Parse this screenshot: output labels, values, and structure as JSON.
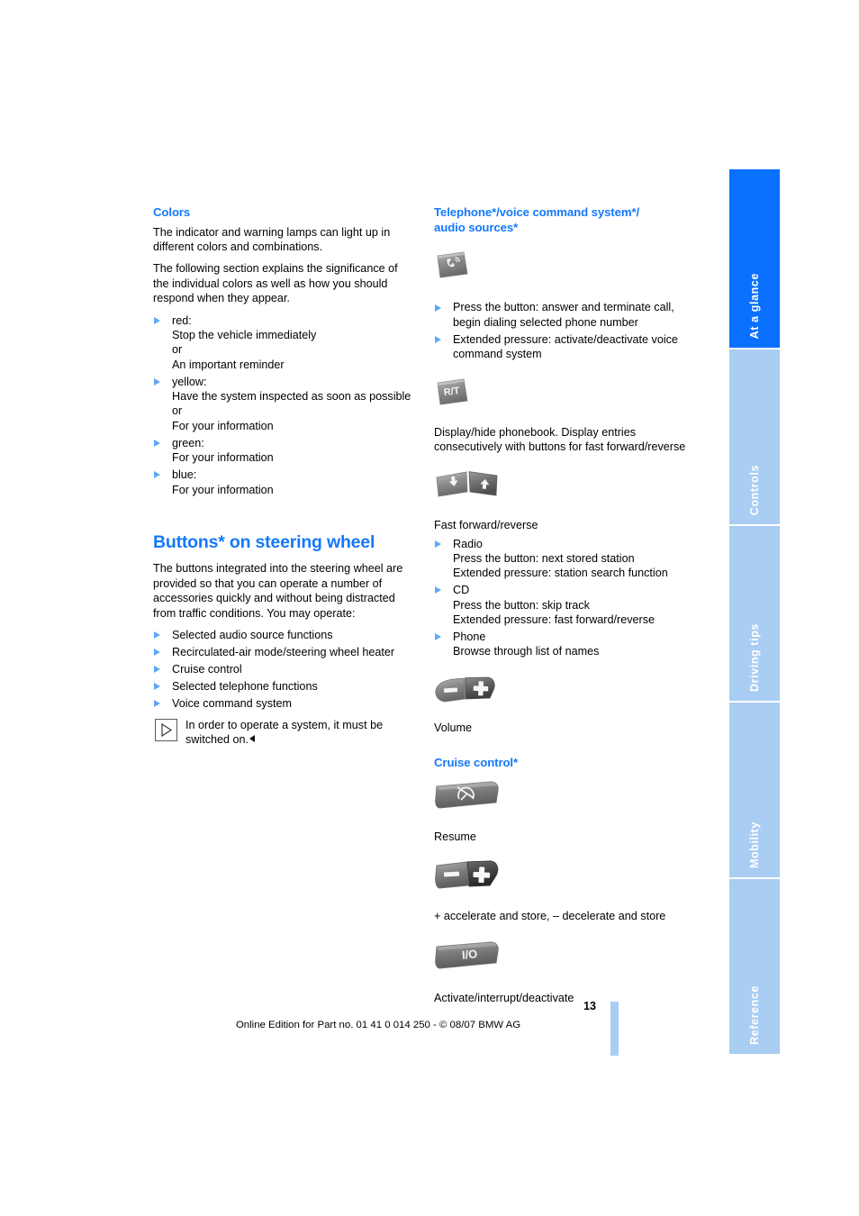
{
  "meta": {
    "page_number": "13",
    "copyright": "Online Edition for Part no. 01 41 0 014 250 - © 08/07 BMW AG"
  },
  "tabs": [
    {
      "label": "At a glance",
      "active": true
    },
    {
      "label": "Controls",
      "active": false
    },
    {
      "label": "Driving tips",
      "active": false
    },
    {
      "label": "Mobility",
      "active": false
    },
    {
      "label": "Reference",
      "active": false
    }
  ],
  "left_column": {
    "colors_section": {
      "heading": "Colors",
      "para1": "The indicator and warning lamps can light up in different colors and combinations.",
      "para2": "The following section explains the significance of the individual colors as well as how you should respond when they appear.",
      "items": [
        {
          "label": "red:",
          "lines": [
            "Stop the vehicle immediately",
            "or",
            "An important reminder"
          ]
        },
        {
          "label": "yellow:",
          "lines": [
            "Have the system inspected as soon as possible",
            "or",
            "For your information"
          ]
        },
        {
          "label": "green:",
          "lines": [
            "For your information"
          ]
        },
        {
          "label": "blue:",
          "lines": [
            "For your information"
          ]
        }
      ]
    },
    "buttons_section": {
      "heading": "Buttons* on steering wheel",
      "para1": "The buttons integrated into the steering wheel are provided so that you can operate a number of accessories quickly and without being distracted from traffic conditions. You may operate:",
      "items": [
        "Selected audio source functions",
        "Recirculated-air mode/steering wheel heater",
        "Cruise control",
        "Selected telephone functions",
        "Voice command system"
      ],
      "note": "In order to operate a system, it must be switched on."
    }
  },
  "right_column": {
    "telephone_section": {
      "heading_line1": "Telephone*/voice command system*/",
      "heading_line2": "audio sources*",
      "phone_button_icon": "steering-wheel-phone-button",
      "phone_items": [
        "Press the button: answer and terminate call, begin dialing selected phone number",
        "Extended pressure: activate/deactivate voice command system"
      ],
      "rt_button_icon": "steering-wheel-rt-button",
      "rt_caption": "Display/hide phonebook. Display entries consecutively with buttons for fast forward/reverse",
      "ff_button_icon": "steering-wheel-fast-forward-reverse-buttons",
      "ff_caption": "Fast forward/reverse",
      "ff_items": [
        {
          "label": "Radio",
          "lines": [
            "Press the button: next stored station",
            "Extended pressure: station search function"
          ]
        },
        {
          "label": "CD",
          "lines": [
            "Press the button: skip track",
            "Extended pressure: fast forward/reverse"
          ]
        },
        {
          "label": "Phone",
          "lines": [
            "Browse through list of names"
          ]
        }
      ],
      "volume_button_icon": "steering-wheel-volume-button",
      "volume_caption": "Volume"
    },
    "cruise_section": {
      "heading": "Cruise control*",
      "resume_button_icon": "cruise-resume-button",
      "resume_caption": "Resume",
      "accel_button_icon": "cruise-accelerate-decelerate-button",
      "accel_caption": "+ accelerate and store, – decelerate and store",
      "io_button_icon": "cruise-io-button",
      "io_caption": "Activate/interrupt/deactivate"
    }
  },
  "colors": {
    "heading_blue": "#1579fb",
    "tab_active_blue": "#0a70fe",
    "tab_inactive_blue": "#a9cdf3",
    "bullet_triangle_blue": "#5fa8f6",
    "text_black": "#000000"
  }
}
